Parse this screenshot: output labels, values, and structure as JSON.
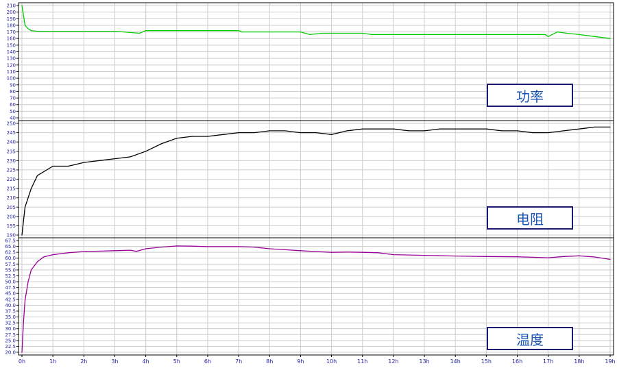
{
  "chart_data": [
    {
      "type": "line",
      "title": "",
      "xlabel": "",
      "ylabel": "",
      "legend": "功率",
      "color": "#00cc00",
      "xlim": [
        0,
        19
      ],
      "ylim": [
        160,
        210
      ],
      "yticks": [
        155,
        160,
        165,
        170,
        175,
        180,
        185,
        190,
        195,
        200,
        205,
        210,
        220,
        230,
        240
      ],
      "yticklabels": [
        "40",
        "50",
        "60",
        "70",
        "80",
        "90",
        "100",
        "110",
        "120",
        "130",
        "140",
        "150",
        "160",
        "170",
        "180",
        "190",
        "200",
        "210"
      ],
      "x": [
        0,
        0.1,
        0.2,
        0.3,
        0.5,
        1,
        2,
        3,
        3.8,
        4,
        5,
        6,
        7,
        7.1,
        8,
        9,
        9.3,
        9.7,
        10,
        11,
        11.3,
        12,
        13,
        14,
        15,
        16,
        16.9,
        17,
        17.3,
        17.6,
        18,
        18.5,
        19
      ],
      "y": [
        210,
        180,
        175,
        172,
        171,
        171,
        171,
        171,
        168,
        172,
        172,
        172,
        172,
        170,
        170,
        170,
        166,
        168,
        168,
        168,
        166,
        166,
        166,
        166,
        166,
        166,
        166,
        163,
        170,
        168,
        166,
        163,
        160
      ]
    },
    {
      "type": "line",
      "title": "",
      "xlabel": "",
      "ylabel": "",
      "legend": "电阻",
      "color": "#000000",
      "xlim": [
        0,
        19
      ],
      "ylim": [
        190,
        250
      ],
      "yticklabels": [
        "190",
        "195",
        "200",
        "205",
        "210",
        "215",
        "220",
        "225",
        "230",
        "235",
        "240",
        "245",
        "250"
      ],
      "x": [
        0,
        0.1,
        0.3,
        0.5,
        1,
        1.5,
        2,
        2.5,
        3,
        3.5,
        4,
        4.5,
        5,
        5.5,
        6,
        6.5,
        7,
        7.5,
        8,
        8.5,
        9,
        9.5,
        10,
        10.5,
        11,
        11.5,
        12,
        12.5,
        13,
        13.5,
        14,
        14.5,
        15,
        15.5,
        16,
        16.5,
        17,
        17.5,
        18,
        18.5,
        19
      ],
      "y": [
        190,
        205,
        215,
        222,
        227,
        227,
        229,
        230,
        231,
        232,
        235,
        239,
        242,
        243,
        243,
        244,
        245,
        245,
        246,
        246,
        245,
        245,
        244,
        246,
        247,
        247,
        247,
        246,
        246,
        247,
        247,
        247,
        247,
        246,
        246,
        245,
        245,
        246,
        247,
        248,
        248
      ]
    },
    {
      "type": "line",
      "title": "",
      "xlabel": "",
      "ylabel": "",
      "legend": "温度",
      "color": "#990099",
      "xlim": [
        0,
        19
      ],
      "ylim": [
        20,
        67.5
      ],
      "yticklabels": [
        "20.0",
        "22.5",
        "25.0",
        "27.5",
        "30.0",
        "32.5",
        "35.0",
        "37.5",
        "40.0",
        "42.5",
        "45.0",
        "47.5",
        "50.0",
        "52.5",
        "55.0",
        "57.5",
        "60.0",
        "62.5",
        "65.0",
        "67.5"
      ],
      "x": [
        0,
        0.05,
        0.1,
        0.2,
        0.3,
        0.5,
        0.7,
        1,
        1.5,
        2,
        3,
        3.5,
        3.7,
        4,
        4.5,
        5,
        5.5,
        6,
        7,
        7.5,
        8,
        8.5,
        9,
        9.5,
        10,
        10.5,
        11,
        11.5,
        12,
        13,
        14,
        15,
        16,
        16.5,
        17,
        17.5,
        18,
        18.5,
        19
      ],
      "y": [
        20,
        33,
        42,
        50,
        55,
        58.5,
        60.5,
        61.5,
        62.3,
        62.8,
        63.2,
        63.4,
        62.9,
        64,
        64.7,
        65.2,
        65.1,
        64.9,
        64.9,
        64.7,
        64,
        63.6,
        63.2,
        62.8,
        62.5,
        62.6,
        62.5,
        62.3,
        61.5,
        61.2,
        60.9,
        60.7,
        60.6,
        60.4,
        60.2,
        60.7,
        61,
        60.5,
        59.5
      ]
    }
  ],
  "xaxis": {
    "labels": [
      "0h",
      "1h",
      "2h",
      "3h",
      "4h",
      "5h",
      "6h",
      "7h",
      "8h",
      "9h",
      "10h",
      "11h",
      "12h",
      "13h",
      "14h",
      "15h",
      "16h",
      "17h",
      "18h",
      "19h"
    ]
  },
  "legends": {
    "power": "功率",
    "resistance": "电阻",
    "temperature": "温度"
  },
  "colors": {
    "power": "#00cc00",
    "resistance": "#000000",
    "temperature": "#990099",
    "axis_text": "#1a1a9e",
    "grid": "#cccccc"
  }
}
